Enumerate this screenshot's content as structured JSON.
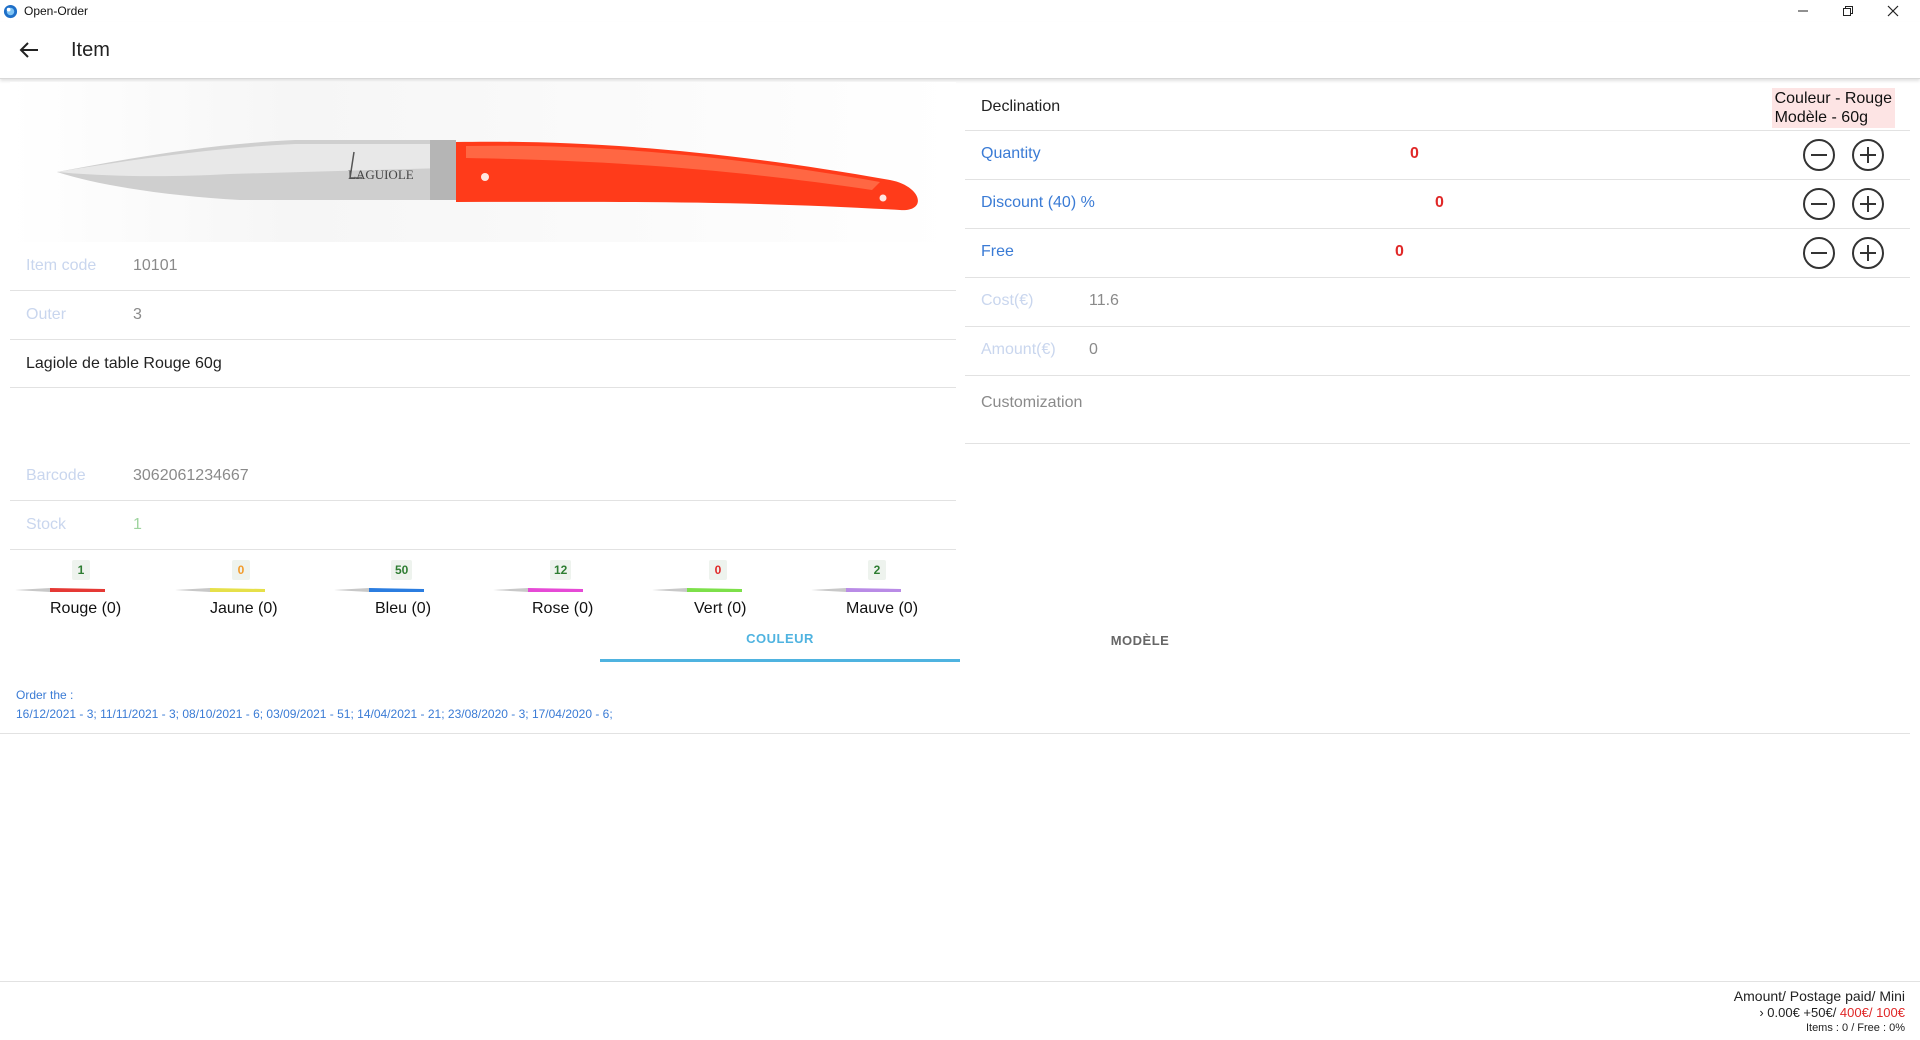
{
  "window": {
    "title": "Open-Order",
    "icon": "open-order-app-icon",
    "controls": [
      "minimize-icon",
      "restore-icon",
      "close-icon"
    ]
  },
  "header": {
    "back_icon": "arrow-left-icon",
    "title": "Item"
  },
  "product": {
    "image": "knife-red-handle-image",
    "image_logo_text": "LAGUIOLE",
    "fields": {
      "item_code_label": "Item code",
      "item_code": "10101",
      "outer_label": "Outer",
      "outer": "3",
      "description": "Lagiole de table Rouge 60g",
      "barcode_label": "Barcode",
      "barcode": "3062061234667",
      "stock_label": "Stock",
      "stock": "1"
    }
  },
  "variants": [
    {
      "badge": "1",
      "badge_color": "#2e7d32",
      "name": "Rouge (0)",
      "handle_color": "#e53935"
    },
    {
      "badge": "0",
      "badge_color": "#f29b2c",
      "name": "Jaune (0)",
      "handle_color": "#e6e04a"
    },
    {
      "badge": "50",
      "badge_color": "#2e7d32",
      "name": "Bleu (0)",
      "handle_color": "#2b7de0"
    },
    {
      "badge": "12",
      "badge_color": "#2e7d32",
      "name": "Rose (0)",
      "handle_color": "#e64ad6"
    },
    {
      "badge": "0",
      "badge_color": "#e02828",
      "name": "Vert (0)",
      "handle_color": "#7de04a"
    },
    {
      "badge": "2",
      "badge_color": "#2e7d32",
      "name": "Mauve (0)",
      "handle_color": "#b98be6"
    }
  ],
  "tabs": [
    {
      "label": "COULEUR",
      "active": true
    },
    {
      "label": "MODÈLE",
      "active": false
    }
  ],
  "orders": {
    "title": "Order the :",
    "list": "16/12/2021 - 3; 11/11/2021 - 3; 08/10/2021 - 6; 03/09/2021 - 51; 14/04/2021 - 21; 23/08/2020 - 3; 17/04/2020 - 6;"
  },
  "right": {
    "declination_label": "Declination",
    "declination_line1": "Couleur - Rouge",
    "declination_line2": "Modèle - 60g",
    "quantity_label": "Quantity",
    "quantity": "0",
    "discount_label": "Discount (40) %",
    "discount": "0",
    "free_label": "Free",
    "free": "0",
    "cost_label": "Cost(€)",
    "cost": "11.6",
    "amount_label": "Amount(€)",
    "amount": "0",
    "customization_label": "Customization",
    "minus_icon": "minus-circle-icon",
    "plus_icon": "plus-circle-icon"
  },
  "footer": {
    "line1": "Amount/ Postage paid/ Mini",
    "line2_prefix": "› 0.00€ +50€/ ",
    "line2_red": "400€/ 100€",
    "line3": "Items : 0 / Free : 0%"
  },
  "colors": {
    "accent_blue": "#3a7bd5",
    "tab_active": "#4fb3e0",
    "red": "#e02828",
    "declination_bg": "#fde4e4"
  }
}
